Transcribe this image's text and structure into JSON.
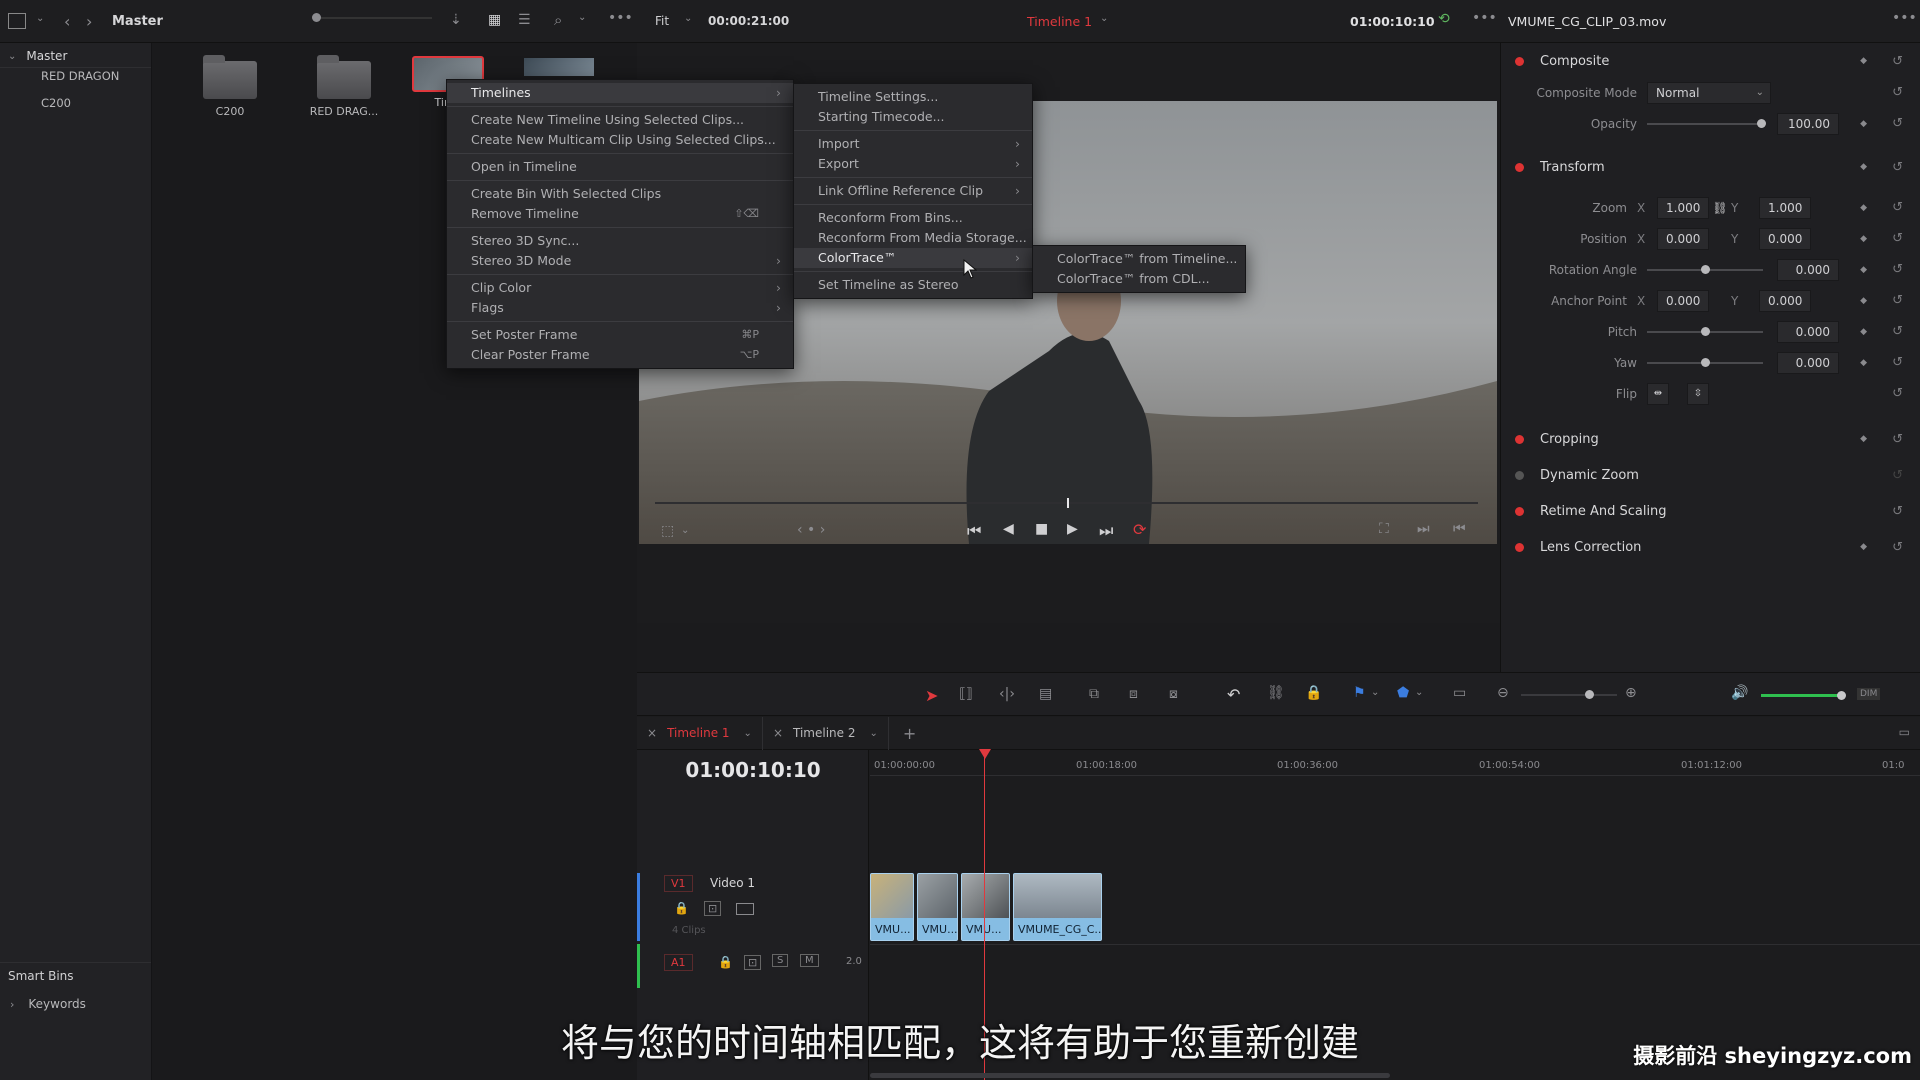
{
  "topbar": {
    "bin_title": "Master",
    "fit_label": "Fit",
    "duration": "00:00:21:00",
    "timeline_name": "Timeline 1",
    "timecode": "01:00:10:10",
    "clip_name": "VMUME_CG_CLIP_03.mov"
  },
  "sidebar": {
    "master_label": "Master",
    "items": [
      "RED DRAGON",
      "C200"
    ],
    "smart_bins_label": "Smart Bins",
    "keywords_label": "Keywords"
  },
  "bin": {
    "items": [
      {
        "label": "C200",
        "icon": "folder-icon"
      },
      {
        "label": "RED DRAG...",
        "icon": "folder-icon"
      },
      {
        "label": "Time",
        "icon": "timeline-icon"
      }
    ]
  },
  "context_menu": {
    "items": [
      {
        "label": "Timelines",
        "arrow": "›",
        "shortcut": ""
      },
      {
        "label": "Create New Timeline Using Selected Clips...",
        "arrow": "",
        "shortcut": ""
      },
      {
        "label": "Create New Multicam Clip Using Selected Clips...",
        "arrow": "",
        "shortcut": ""
      },
      {
        "label": "Open in Timeline",
        "arrow": "",
        "shortcut": ""
      },
      {
        "label": "Create Bin With Selected Clips",
        "arrow": "",
        "shortcut": ""
      },
      {
        "label": "Remove Timeline",
        "arrow": "",
        "shortcut": "⇧⌫"
      },
      {
        "label": "Stereo 3D Sync...",
        "arrow": "",
        "shortcut": ""
      },
      {
        "label": "Stereo 3D Mode",
        "arrow": "›",
        "shortcut": ""
      },
      {
        "label": "Clip Color",
        "arrow": "›",
        "shortcut": ""
      },
      {
        "label": "Flags",
        "arrow": "›",
        "shortcut": ""
      },
      {
        "label": "Set Poster Frame",
        "arrow": "",
        "shortcut": "⌘P"
      },
      {
        "label": "Clear Poster Frame",
        "arrow": "",
        "shortcut": "⌥P"
      }
    ]
  },
  "submenu_timelines": {
    "items": [
      {
        "label": "Timeline Settings...",
        "arrow": ""
      },
      {
        "label": "Starting Timecode...",
        "arrow": ""
      },
      {
        "label": "Import",
        "arrow": "›"
      },
      {
        "label": "Export",
        "arrow": "›"
      },
      {
        "label": "Link Offline Reference Clip",
        "arrow": "›"
      },
      {
        "label": "Reconform From Bins...",
        "arrow": ""
      },
      {
        "label": "Reconform From Media Storage...",
        "arrow": ""
      },
      {
        "label": "ColorTrace™",
        "arrow": "›"
      },
      {
        "label": "Set Timeline as Stereo",
        "arrow": ""
      }
    ]
  },
  "submenu_colortrace": {
    "items": [
      {
        "label": "ColorTrace™ from Timeline..."
      },
      {
        "label": "ColorTrace™ from CDL..."
      }
    ]
  },
  "inspector": {
    "composite": {
      "title": "Composite",
      "mode_label": "Composite Mode",
      "mode_value": "Normal",
      "opacity_label": "Opacity",
      "opacity_value": "100.00"
    },
    "transform": {
      "title": "Transform",
      "zoom_label": "Zoom",
      "zoom_x": "1.000",
      "zoom_y": "1.000",
      "position_label": "Position",
      "position_x": "0.000",
      "position_y": "0.000",
      "rotation_label": "Rotation Angle",
      "rotation_value": "0.000",
      "anchor_label": "Anchor Point",
      "anchor_x": "0.000",
      "anchor_y": "0.000",
      "pitch_label": "Pitch",
      "pitch_value": "0.000",
      "yaw_label": "Yaw",
      "yaw_value": "0.000",
      "flip_label": "Flip",
      "x_label": "X",
      "y_label": "Y"
    },
    "sections": [
      "Cropping",
      "Dynamic Zoom",
      "Retime And Scaling",
      "Lens Correction"
    ]
  },
  "timeline": {
    "tabs": [
      "Timeline 1",
      "Timeline 2"
    ],
    "timecode": "01:00:10:10",
    "ruler": [
      "01:00:00:00",
      "01:00:18:00",
      "01:00:36:00",
      "01:00:54:00",
      "01:01:12:00",
      "01:0"
    ],
    "v1_label": "V1",
    "v1_name": "Video 1",
    "v1_clips_count": "4 Clips",
    "a1_label": "A1",
    "a1_s": "S",
    "a1_m": "M",
    "a1_level": "2.0",
    "clips": [
      "VMU...",
      "VMU...",
      "VMU...",
      "VMUME_CG_C..."
    ],
    "dim_label": "DIM"
  },
  "subtitle": "将与您的时间轴相匹配，这将有助于您重新创建",
  "watermark": "摄影前沿 sheyingzyz.com",
  "colors": {
    "accent_red": "#e0393e",
    "clip_blue": "#7fb3d8",
    "audio_green": "#2fbf4f"
  }
}
